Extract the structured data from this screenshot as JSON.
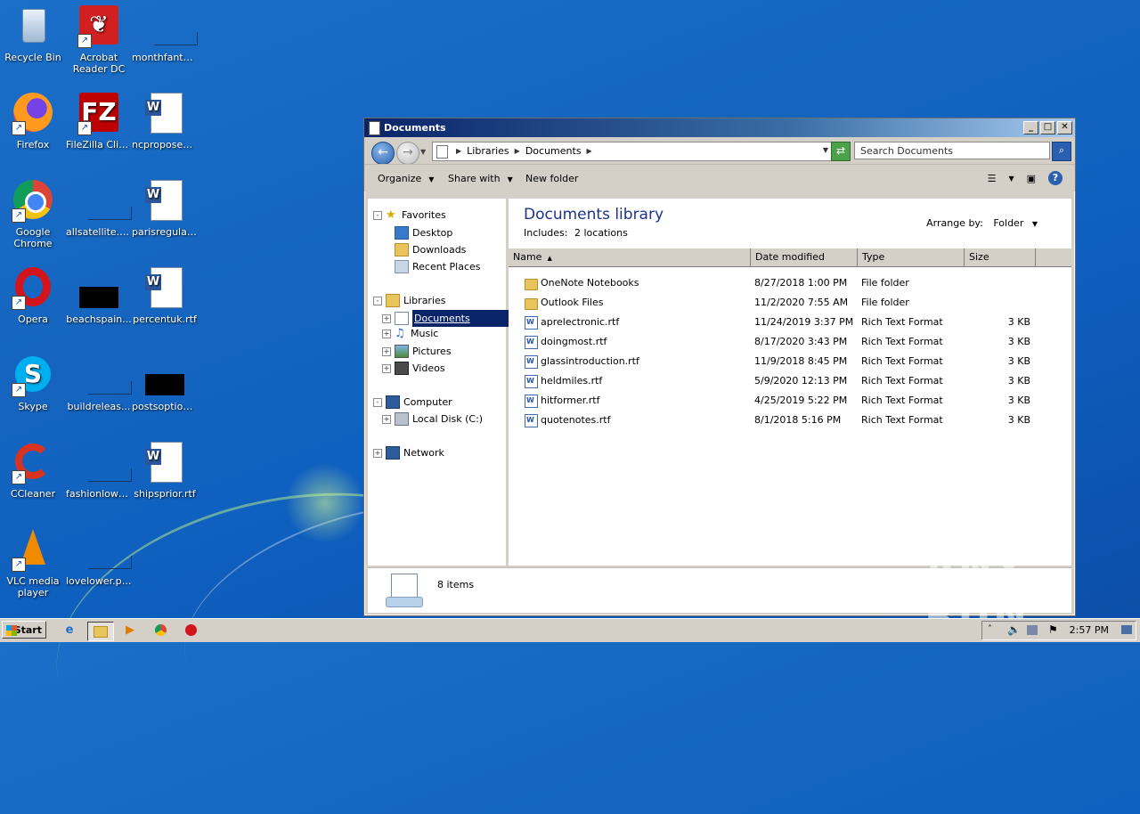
{
  "desktop": {
    "icons": [
      {
        "label": "Recycle Bin",
        "icon": "recycle-bin-icon"
      },
      {
        "label": "Acrobat Reader DC",
        "icon": "acrobat-icon"
      },
      {
        "label": "monthfanta...",
        "icon": "image-file-icon"
      },
      {
        "label": "Firefox",
        "icon": "firefox-icon"
      },
      {
        "label": "FileZilla Client",
        "icon": "filezilla-icon"
      },
      {
        "label": "ncproposed...",
        "icon": "word-doc-icon"
      },
      {
        "label": "Google Chrome",
        "icon": "chrome-icon"
      },
      {
        "label": "allsatellite.png",
        "icon": "image-file-icon"
      },
      {
        "label": "parisregular...",
        "icon": "word-doc-icon"
      },
      {
        "label": "Opera",
        "icon": "opera-icon"
      },
      {
        "label": "beachspain...",
        "icon": "image-file-icon"
      },
      {
        "label": "percentuk.rtf",
        "icon": "word-doc-icon"
      },
      {
        "label": "Skype",
        "icon": "skype-icon"
      },
      {
        "label": "buildreleas...",
        "icon": "image-file-icon"
      },
      {
        "label": "postsoption...",
        "icon": "image-file-icon"
      },
      {
        "label": "CCleaner",
        "icon": "ccleaner-icon"
      },
      {
        "label": "fashionlowe...",
        "icon": "image-file-icon"
      },
      {
        "label": "shipsprior.rtf",
        "icon": "word-doc-icon"
      },
      {
        "label": "VLC media player",
        "icon": "vlc-icon"
      },
      {
        "label": "lovelower.png",
        "icon": "image-file-icon"
      }
    ]
  },
  "window": {
    "title": "Documents",
    "address": {
      "crumb1": "Libraries",
      "crumb2": "Documents"
    },
    "search_placeholder": "Search Documents",
    "toolbar": {
      "organize": "Organize",
      "share": "Share with",
      "new_folder": "New folder"
    },
    "nav": {
      "favorites": "Favorites",
      "desktop": "Desktop",
      "downloads": "Downloads",
      "recent": "Recent Places",
      "libraries": "Libraries",
      "documents": "Documents",
      "music": "Music",
      "pictures": "Pictures",
      "videos": "Videos",
      "computer": "Computer",
      "local_disk": "Local Disk (C:)",
      "network": "Network"
    },
    "library": {
      "title": "Documents library",
      "includes_label": "Includes:",
      "includes_value": "2 locations",
      "arrange_label": "Arrange by:",
      "arrange_value": "Folder"
    },
    "columns": {
      "name": "Name",
      "date": "Date modified",
      "type": "Type",
      "size": "Size"
    },
    "files": [
      {
        "name": "OneNote Notebooks",
        "date": "8/27/2018 1:00 PM",
        "type": "File folder",
        "size": "",
        "kind": "folder"
      },
      {
        "name": "Outlook Files",
        "date": "11/2/2020 7:55 AM",
        "type": "File folder",
        "size": "",
        "kind": "folder"
      },
      {
        "name": "aprelectronic.rtf",
        "date": "11/24/2019 3:37 PM",
        "type": "Rich Text Format",
        "size": "3 KB",
        "kind": "rtf"
      },
      {
        "name": "doingmost.rtf",
        "date": "8/17/2020 3:43 PM",
        "type": "Rich Text Format",
        "size": "3 KB",
        "kind": "rtf"
      },
      {
        "name": "glassintroduction.rtf",
        "date": "11/9/2018 8:45 PM",
        "type": "Rich Text Format",
        "size": "3 KB",
        "kind": "rtf"
      },
      {
        "name": "heldmiles.rtf",
        "date": "5/9/2020 12:13 PM",
        "type": "Rich Text Format",
        "size": "3 KB",
        "kind": "rtf"
      },
      {
        "name": "hitformer.rtf",
        "date": "4/25/2019 5:22 PM",
        "type": "Rich Text Format",
        "size": "3 KB",
        "kind": "rtf"
      },
      {
        "name": "quotenotes.rtf",
        "date": "8/1/2018 5:16 PM",
        "type": "Rich Text Format",
        "size": "3 KB",
        "kind": "rtf"
      }
    ],
    "status": "8 items"
  },
  "taskbar": {
    "start": "Start",
    "clock": "2:57 PM"
  },
  "watermark": "ANY RUN"
}
